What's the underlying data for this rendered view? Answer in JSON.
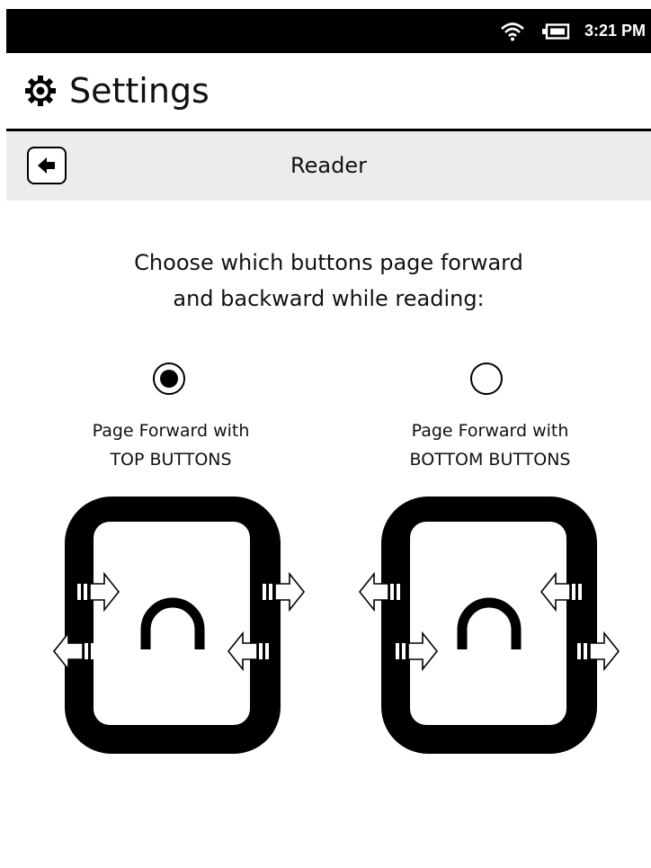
{
  "status_bar": {
    "time": "3:21 PM",
    "icons": [
      "wifi-icon",
      "battery-icon"
    ]
  },
  "header": {
    "icon": "gear-icon",
    "title": "Settings"
  },
  "subbar": {
    "back_icon": "arrow-left-icon",
    "title": "Reader"
  },
  "instruction": {
    "line1": "Choose which buttons page forward",
    "line2": "and backward while reading:"
  },
  "options": [
    {
      "line1": "Page Forward with",
      "line2": "TOP BUTTONS",
      "selected": true
    },
    {
      "line1": "Page Forward with",
      "line2": "BOTTOM BUTTONS",
      "selected": false
    }
  ]
}
